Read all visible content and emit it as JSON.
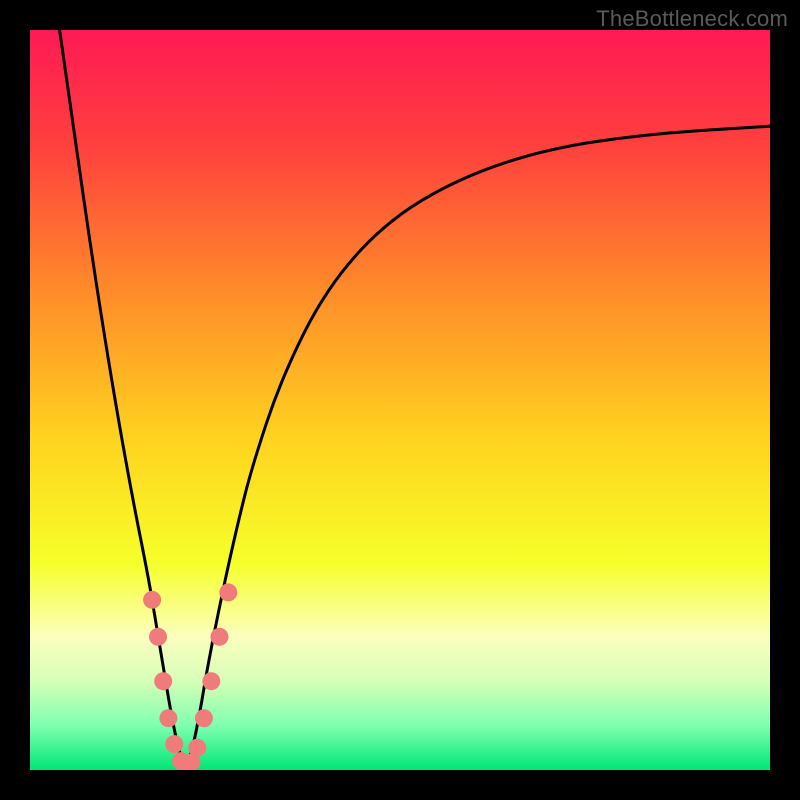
{
  "watermark": "TheBottleneck.com",
  "chart_data": {
    "type": "line",
    "title": "",
    "xlabel": "",
    "ylabel": "",
    "xlim": [
      0,
      100
    ],
    "ylim": [
      0,
      100
    ],
    "background_gradient": {
      "stops": [
        {
          "pos": 0.0,
          "color": "#ff1a55"
        },
        {
          "pos": 0.15,
          "color": "#ff3e3e"
        },
        {
          "pos": 0.35,
          "color": "#ff8a2a"
        },
        {
          "pos": 0.55,
          "color": "#ffd21f"
        },
        {
          "pos": 0.72,
          "color": "#f6ff2a"
        },
        {
          "pos": 0.82,
          "color": "#fbffbe"
        },
        {
          "pos": 0.88,
          "color": "#d6ffb8"
        },
        {
          "pos": 0.94,
          "color": "#7fffb0"
        },
        {
          "pos": 1.0,
          "color": "#00e676"
        }
      ]
    },
    "series": [
      {
        "name": "bottleneck-curve",
        "color": "#000000",
        "x": [
          4,
          6,
          8,
          10,
          12,
          14,
          16,
          17,
          18,
          19,
          20,
          21,
          22,
          23,
          24,
          26,
          28,
          30,
          34,
          40,
          48,
          58,
          70,
          84,
          100
        ],
        "y": [
          100,
          86,
          72,
          59,
          47,
          36,
          26,
          20,
          14,
          8,
          3,
          0,
          3,
          8,
          14,
          24,
          33,
          41,
          53,
          65,
          74,
          80,
          84,
          86,
          87
        ]
      }
    ],
    "markers": {
      "name": "highlighted-points",
      "color": "#ef7b7b",
      "radius": 9,
      "points": [
        {
          "x": 16.5,
          "y": 23
        },
        {
          "x": 17.3,
          "y": 18
        },
        {
          "x": 18.0,
          "y": 12
        },
        {
          "x": 18.7,
          "y": 7
        },
        {
          "x": 19.5,
          "y": 3.5
        },
        {
          "x": 20.4,
          "y": 1.2
        },
        {
          "x": 21.0,
          "y": 0.4
        },
        {
          "x": 21.8,
          "y": 1.0
        },
        {
          "x": 22.6,
          "y": 3.0
        },
        {
          "x": 23.5,
          "y": 7
        },
        {
          "x": 24.5,
          "y": 12
        },
        {
          "x": 25.6,
          "y": 18
        },
        {
          "x": 26.8,
          "y": 24
        }
      ]
    }
  }
}
